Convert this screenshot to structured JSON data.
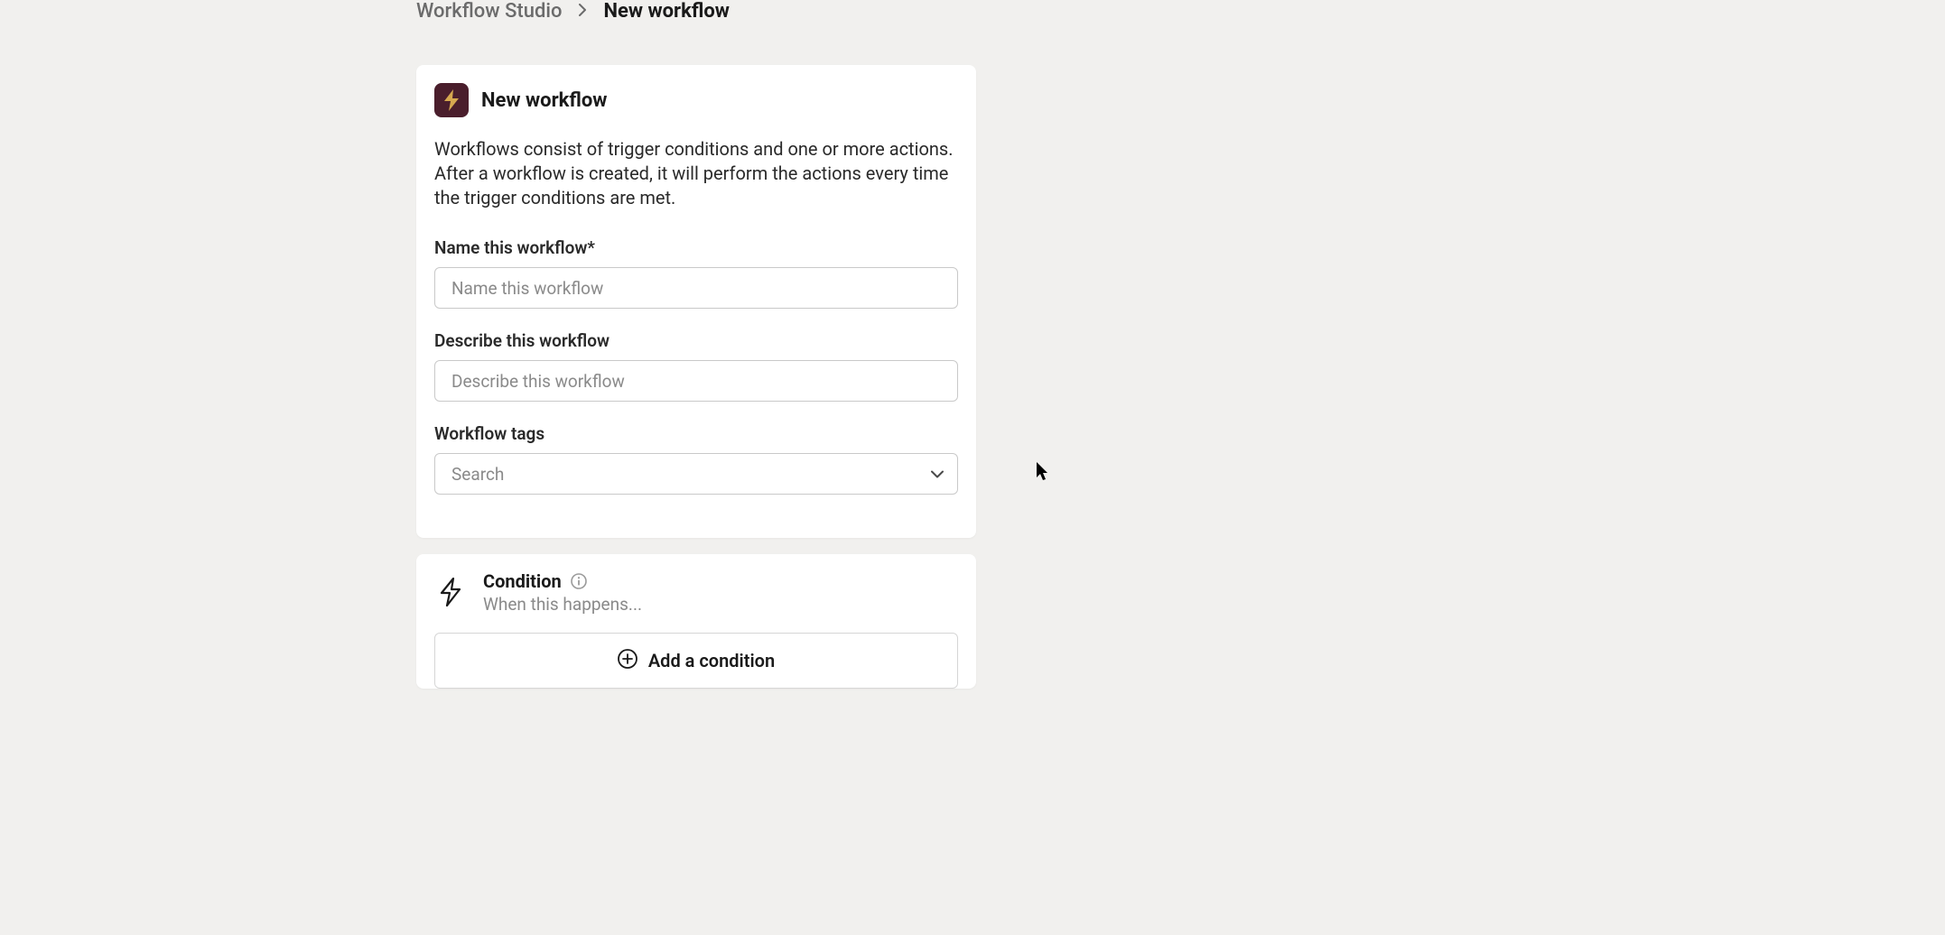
{
  "breadcrumb": {
    "parent": "Workflow Studio",
    "current": "New workflow"
  },
  "header": {
    "title": "New workflow",
    "description": "Workflows consist of trigger conditions and one or more actions. After a workflow is created, it will perform the actions every time the trigger conditions are met."
  },
  "fields": {
    "name": {
      "label": "Name this workflow*",
      "placeholder": "Name this workflow",
      "value": ""
    },
    "describe": {
      "label": "Describe this workflow",
      "placeholder": "Describe this workflow",
      "value": ""
    },
    "tags": {
      "label": "Workflow tags",
      "placeholder": "Search"
    }
  },
  "condition": {
    "title": "Condition",
    "subtitle": "When this happens...",
    "addLabel": "Add a condition"
  },
  "icons": {
    "bolt": "bolt-icon",
    "boltOutline": "bolt-outline-icon",
    "info": "info-icon",
    "plus": "plus-circle-icon",
    "chevron": "chevron-down-icon"
  },
  "colors": {
    "bg": "#f1f0ee",
    "card": "#ffffff",
    "boltBadgeBg": "#4a1e2c",
    "boltFill": "#d6a84f",
    "textPrimary": "#1a1a1a",
    "textSecondary": "#8a8a8a",
    "border": "#c9c9c9"
  }
}
